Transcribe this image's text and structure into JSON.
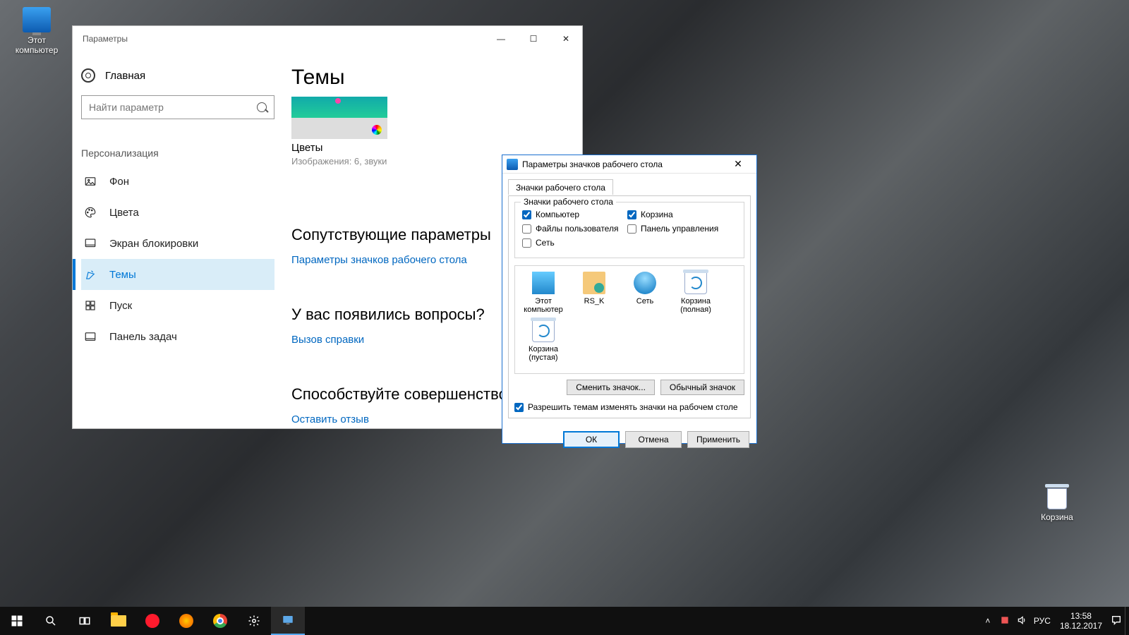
{
  "desktop": {
    "icons": {
      "thisPc": "Этот\nкомпьютер",
      "recycleBin": "Корзина"
    }
  },
  "settings": {
    "title": "Параметры",
    "home": "Главная",
    "searchPlaceholder": "Найти параметр",
    "section": "Персонализация",
    "nav": [
      {
        "label": "Фон"
      },
      {
        "label": "Цвета"
      },
      {
        "label": "Экран блокировки"
      },
      {
        "label": "Темы"
      },
      {
        "label": "Пуск"
      },
      {
        "label": "Панель задач"
      }
    ],
    "pageTitle": "Темы",
    "themeName": "Цветы",
    "themeMeta": "Изображения: 6, звуки",
    "relatedHeading": "Сопутствующие параметры",
    "relatedLink": "Параметры значков рабочего стола",
    "helpHeading": "У вас появились вопросы?",
    "helpLink": "Вызов справки",
    "feedbackHeading": "Способствуйте совершенствованию",
    "feedbackLink": "Оставить отзыв"
  },
  "dialog": {
    "title": "Параметры значков рабочего стола",
    "tab": "Значки рабочего стола",
    "groupLegend": "Значки рабочего стола",
    "checks": {
      "computer": "Компьютер",
      "recycle": "Корзина",
      "userFiles": "Файлы пользователя",
      "controlPanel": "Панель управления",
      "network": "Сеть"
    },
    "icons": {
      "thisPc": "Этот\nкомпьютер",
      "user": "RS_K",
      "network": "Сеть",
      "binFull": "Корзина\n(полная)",
      "binEmpty": "Корзина\n(пустая)"
    },
    "changeIcon": "Сменить значок...",
    "defaultIcon": "Обычный значок",
    "allowThemes": "Разрешить темам изменять значки на рабочем столе",
    "ok": "ОК",
    "cancel": "Отмена",
    "apply": "Применить"
  },
  "taskbar": {
    "lang": "РУС",
    "time": "13:58",
    "date": "18.12.2017"
  }
}
